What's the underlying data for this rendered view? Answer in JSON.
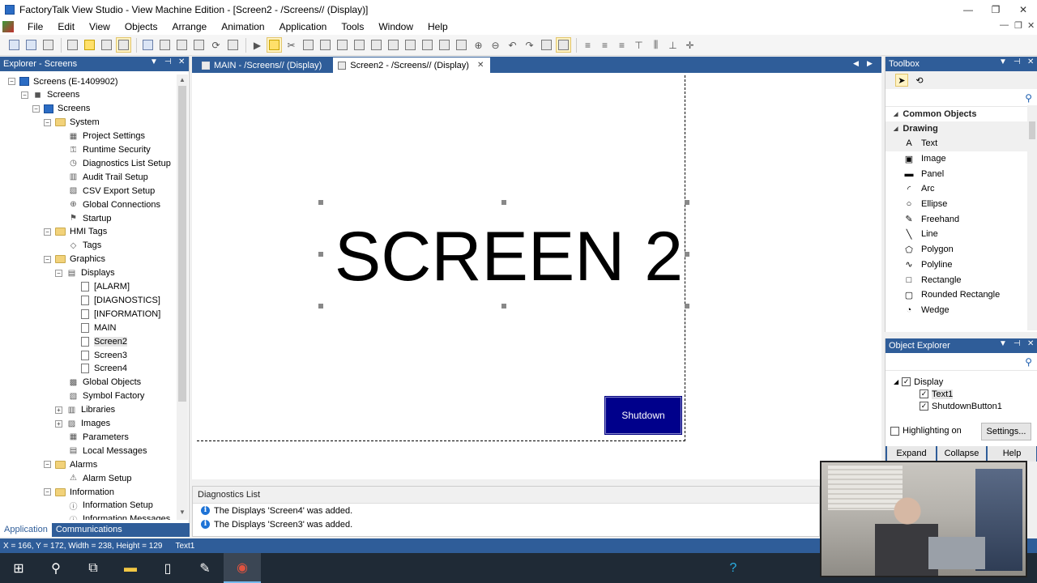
{
  "window": {
    "title": "FactoryTalk View Studio - View Machine Edition - [Screen2 - /Screens// (Display)]"
  },
  "menu": [
    "File",
    "Edit",
    "View",
    "Objects",
    "Arrange",
    "Animation",
    "Application",
    "Tools",
    "Window",
    "Help"
  ],
  "explorer": {
    "title": "Explorer - Screens",
    "tree": [
      {
        "label": "Screens (E-1409902)",
        "level": 0,
        "exp": "-",
        "icon": "computer-icon"
      },
      {
        "label": "Screens",
        "level": 1,
        "exp": "-",
        "icon": "application-icon"
      },
      {
        "label": "Screens",
        "level": 2,
        "exp": "-",
        "icon": "project-icon"
      },
      {
        "label": "System",
        "level": 3,
        "exp": "-",
        "icon": "folder-icon"
      },
      {
        "label": "Project Settings",
        "level": 4,
        "icon": "settings-icon"
      },
      {
        "label": "Runtime Security",
        "level": 4,
        "icon": "key-icon"
      },
      {
        "label": "Diagnostics List Setup",
        "level": 4,
        "icon": "clock-icon"
      },
      {
        "label": "Audit Trail Setup",
        "level": 4,
        "icon": "audit-icon"
      },
      {
        "label": "CSV Export Setup",
        "level": 4,
        "icon": "export-icon"
      },
      {
        "label": "Global Connections",
        "level": 4,
        "icon": "globe-icon"
      },
      {
        "label": "Startup",
        "level": 4,
        "icon": "flag-icon"
      },
      {
        "label": "HMI Tags",
        "level": 3,
        "exp": "-",
        "icon": "folder-icon"
      },
      {
        "label": "Tags",
        "level": 4,
        "icon": "tag-icon"
      },
      {
        "label": "Graphics",
        "level": 3,
        "exp": "-",
        "icon": "folder-icon"
      },
      {
        "label": "Displays",
        "level": 4,
        "exp": "-",
        "icon": "displays-icon"
      },
      {
        "label": "[ALARM]",
        "level": 5,
        "icon": "display-icon"
      },
      {
        "label": "[DIAGNOSTICS]",
        "level": 5,
        "icon": "display-icon"
      },
      {
        "label": "[INFORMATION]",
        "level": 5,
        "icon": "display-icon"
      },
      {
        "label": "MAIN",
        "level": 5,
        "icon": "display-icon"
      },
      {
        "label": "Screen2",
        "level": 5,
        "icon": "display-icon",
        "selected": true
      },
      {
        "label": "Screen3",
        "level": 5,
        "icon": "display-icon"
      },
      {
        "label": "Screen4",
        "level": 5,
        "icon": "display-icon"
      },
      {
        "label": "Global Objects",
        "level": 4,
        "icon": "global-objects-icon"
      },
      {
        "label": "Symbol Factory",
        "level": 4,
        "icon": "symbol-factory-icon"
      },
      {
        "label": "Libraries",
        "level": 4,
        "exp": "+",
        "icon": "libraries-icon"
      },
      {
        "label": "Images",
        "level": 4,
        "exp": "+",
        "icon": "images-icon"
      },
      {
        "label": "Parameters",
        "level": 4,
        "icon": "parameters-icon"
      },
      {
        "label": "Local Messages",
        "level": 4,
        "icon": "messages-icon"
      },
      {
        "label": "Alarms",
        "level": 3,
        "exp": "-",
        "icon": "folder-icon"
      },
      {
        "label": "Alarm Setup",
        "level": 4,
        "icon": "alarm-icon"
      },
      {
        "label": "Information",
        "level": 3,
        "exp": "-",
        "icon": "folder-icon"
      },
      {
        "label": "Information Setup",
        "level": 4,
        "icon": "info-setup-icon"
      },
      {
        "label": "Information Messages",
        "level": 4,
        "icon": "info-messages-icon"
      }
    ],
    "tabs": [
      "Application",
      "Communications"
    ]
  },
  "doc_tabs": [
    {
      "label": "MAIN - /Screens// (Display)",
      "active": false
    },
    {
      "label": "Screen2 - /Screens// (Display)",
      "active": true
    }
  ],
  "canvas": {
    "text1": "SCREEN 2",
    "shutdown_label": "Shutdown"
  },
  "diagnostics": {
    "title": "Diagnostics List",
    "rows": [
      "The Displays 'Screen4' was added.",
      "The Displays 'Screen3' was added."
    ]
  },
  "toolbox": {
    "title": "Toolbox",
    "groups": [
      "Common Objects",
      "Drawing"
    ],
    "items": [
      {
        "label": "Text",
        "icon": "A",
        "name": "text"
      },
      {
        "label": "Image",
        "icon": "▣",
        "name": "image"
      },
      {
        "label": "Panel",
        "icon": "▬",
        "name": "panel"
      },
      {
        "label": "Arc",
        "icon": "◜",
        "name": "arc"
      },
      {
        "label": "Ellipse",
        "icon": "○",
        "name": "ellipse"
      },
      {
        "label": "Freehand",
        "icon": "✎",
        "name": "freehand"
      },
      {
        "label": "Line",
        "icon": "╲",
        "name": "line"
      },
      {
        "label": "Polygon",
        "icon": "⬠",
        "name": "polygon"
      },
      {
        "label": "Polyline",
        "icon": "∿",
        "name": "polyline"
      },
      {
        "label": "Rectangle",
        "icon": "□",
        "name": "rectangle"
      },
      {
        "label": "Rounded Rectangle",
        "icon": "▢",
        "name": "rounded-rectangle"
      },
      {
        "label": "Wedge",
        "icon": "◔",
        "name": "wedge"
      }
    ]
  },
  "object_explorer": {
    "title": "Object Explorer",
    "root": "Display",
    "children": [
      "Text1",
      "ShutdownButton1"
    ],
    "highlighting_label": "Highlighting on",
    "settings_label": "Settings...",
    "buttons": [
      "Expand",
      "Collapse",
      "Help"
    ]
  },
  "status": {
    "coords": "X = 166, Y = 172, Width = 238, Height = 129",
    "object": "Text1"
  },
  "colors": {
    "accent": "#2f5d99",
    "shutdown_button": "#00008b"
  }
}
